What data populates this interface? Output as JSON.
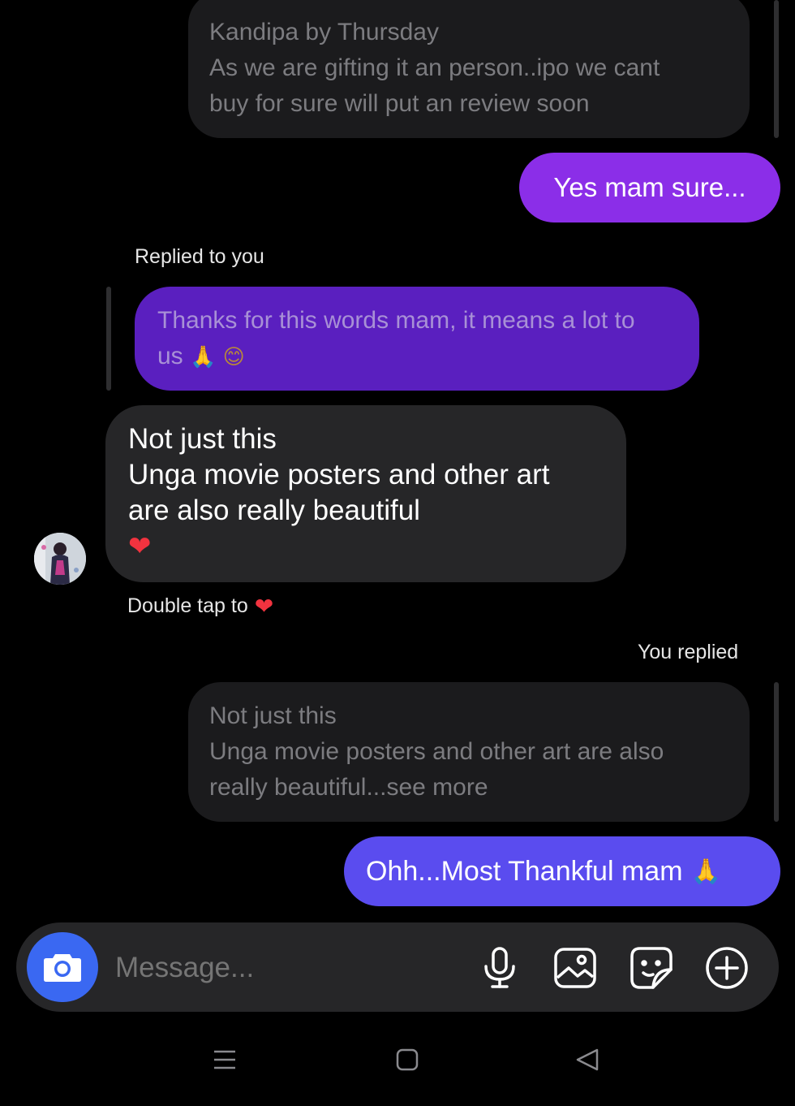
{
  "thread": {
    "quoted_top": {
      "lines": "Kandipa by Thursday\nAs we are gifting it an person..ipo we cant\nbuy for sure will put an review soon"
    },
    "msg_yes": "Yes mam sure...",
    "replied_label": "Replied to you",
    "quoted_reply": {
      "text": "Thanks for this words mam, it means a lot to\nus",
      "emojis": "🙏 😊"
    },
    "received": {
      "lines": "Not just this\nUnga movie posters and other art\nare also really beautiful",
      "heart": "❤"
    },
    "double_tap": {
      "label": "Double tap to",
      "heart": "❤"
    },
    "you_replied_label": "You replied",
    "quoted_bottom": {
      "lines": "Not just this\nUnga movie posters and other art are also\nreally beautiful...see more"
    },
    "msg_thankful": {
      "text": "Ohh...Most Thankful mam",
      "emoji": "🙏"
    }
  },
  "composer": {
    "placeholder": "Message..."
  },
  "icons": {
    "camera": "camera-icon",
    "mic": "microphone-icon",
    "gallery": "gallery-icon",
    "sticker": "sticker-icon",
    "add": "plus-circle-icon",
    "nav_menu": "menu-icon",
    "nav_home": "home-icon",
    "nav_back": "back-icon"
  },
  "colors": {
    "background": "#000000",
    "bubble_received": "#262628",
    "bubble_quoted": "#1b1b1d",
    "bubble_purple": "#8b2ee8",
    "bubble_quoted_purple": "#5a1fbf",
    "bubble_blue": "#5a4cef",
    "camera_button": "#3a68f2",
    "heart": "#f2333f"
  }
}
